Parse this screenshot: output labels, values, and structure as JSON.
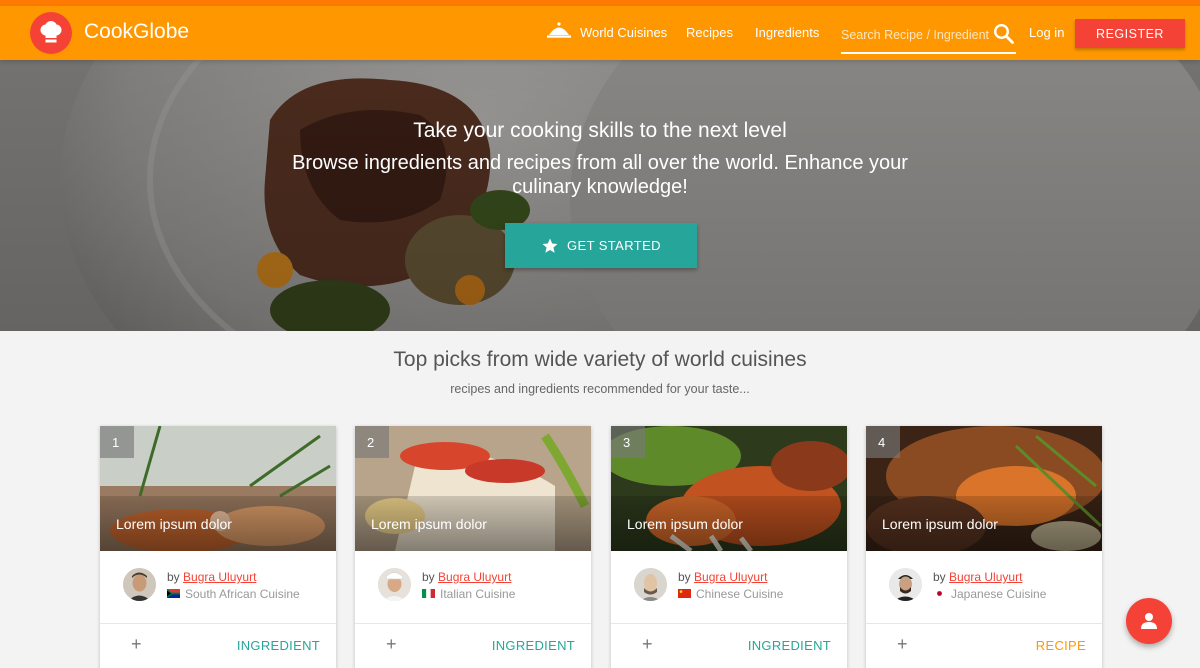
{
  "header": {
    "brand": "CookGlobe",
    "nav": [
      "World Cuisines",
      "Recipes",
      "Ingredients"
    ],
    "search_placeholder": "Search Recipe / Ingredient",
    "login": "Log in",
    "register": "REGISTER"
  },
  "hero": {
    "title": "Take your cooking skills to the next level",
    "subtitle": "Browse ingredients and recipes from all over the world. Enhance your culinary knowledge!",
    "cta": "GET STARTED"
  },
  "section": {
    "title": "Top picks from wide variety of world cuisines",
    "subtitle": "recipes and ingredients recommended for your taste..."
  },
  "cards": [
    {
      "rank": "1",
      "title": "Lorem ipsum dolor",
      "by": "by",
      "author": "Bugra Uluyurt",
      "cuisine": "South African Cuisine",
      "action": "+",
      "type": "INGREDIENT"
    },
    {
      "rank": "2",
      "title": "Lorem ipsum dolor",
      "by": "by",
      "author": "Bugra Uluyurt",
      "cuisine": "Italian Cuisine",
      "action": "+",
      "type": "INGREDIENT"
    },
    {
      "rank": "3",
      "title": "Lorem ipsum dolor",
      "by": "by",
      "author": "Bugra Uluyurt",
      "cuisine": "Chinese Cuisine",
      "action": "+",
      "type": "INGREDIENT"
    },
    {
      "rank": "4",
      "title": "Lorem ipsum dolor",
      "by": "by",
      "author": "Bugra Uluyurt",
      "cuisine": "Japanese Cuisine",
      "action": "+",
      "type": "RECIPE"
    }
  ],
  "colors": {
    "header": "#ff9800",
    "accent_red": "#f44336",
    "teal": "#26a69a",
    "ingredient_label": "#26a69a",
    "recipe_label": "#ff9800"
  },
  "icons": [
    "chef-hat-icon",
    "cloche-icon",
    "search-icon",
    "star-icon",
    "user-icon",
    "plus-icon"
  ]
}
